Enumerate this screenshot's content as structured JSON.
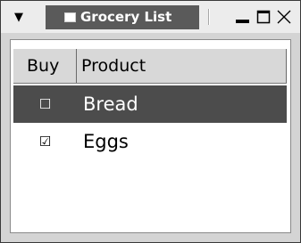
{
  "window": {
    "title": "Grocery List",
    "menu_glyph": "▼"
  },
  "table": {
    "columns": [
      {
        "label": "Buy"
      },
      {
        "label": "Product"
      }
    ],
    "rows": [
      {
        "checked": false,
        "check_glyph": "☐",
        "product": "Bread",
        "selected": true
      },
      {
        "checked": true,
        "check_glyph": "☑",
        "product": "Eggs",
        "selected": false
      }
    ]
  },
  "colors": {
    "selection": "#4c4c4c",
    "title_tab": "#5a5a5a",
    "window_bg": "#d4d4d4"
  }
}
